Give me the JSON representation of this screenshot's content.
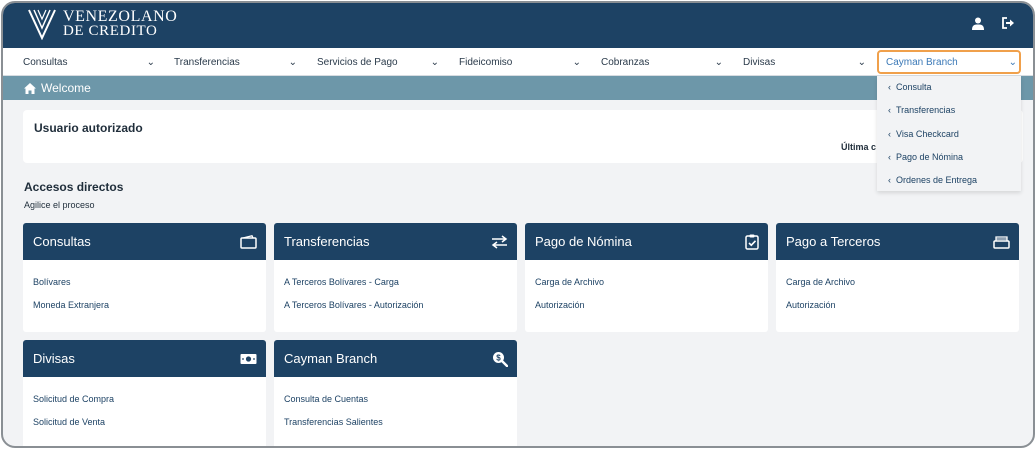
{
  "header": {
    "logo_line1": "VENEZOLANO",
    "logo_line2": "DE CREDITO",
    "icons": [
      "user-icon",
      "logout-icon"
    ]
  },
  "nav": {
    "items": [
      {
        "label": "Consultas"
      },
      {
        "label": "Transferencias"
      },
      {
        "label": "Servicios de Pago"
      },
      {
        "label": "Fideicomiso"
      },
      {
        "label": "Cobranzas"
      },
      {
        "label": "Divisas"
      },
      {
        "label": "Cayman Branch"
      }
    ],
    "active": "Cayman Branch"
  },
  "breadcrumb": {
    "label": "Welcome"
  },
  "user_panel": {
    "title": "Usuario autorizado",
    "last_access": "Última c"
  },
  "shortcuts": {
    "title": "Accesos directos",
    "subtitle": "Agilice el proceso"
  },
  "cards": [
    {
      "title": "Consultas",
      "icon": "wallet-icon",
      "links": [
        "Bolívares",
        "Moneda Extranjera"
      ]
    },
    {
      "title": "Transferencias",
      "icon": "transfer-arrows-icon",
      "links": [
        "A Terceros Bolívares - Carga",
        "A Terceros Bolívares - Autorización"
      ]
    },
    {
      "title": "Pago de Nómina",
      "icon": "clipboard-check-icon",
      "links": [
        "Carga de Archivo",
        "Autorización"
      ]
    },
    {
      "title": "Pago a Terceros",
      "icon": "cash-register-icon",
      "links": [
        "Carga de Archivo",
        "Autorización"
      ]
    },
    {
      "title": "Divisas",
      "icon": "banknote-icon",
      "links": [
        "Solicitud de Compra",
        "Solicitud de Venta"
      ]
    },
    {
      "title": "Cayman Branch",
      "icon": "search-dollar-icon",
      "links": [
        "Consulta de Cuentas",
        "Transferencias Salientes"
      ]
    }
  ],
  "dropdown": {
    "items": [
      "Consulta",
      "Transferencias",
      "Visa Checkcard",
      "Pago de Nómina",
      "Ordenes de Entrega"
    ]
  },
  "colors": {
    "primary": "#1d4264",
    "breadcrumb": "#6d97a9",
    "highlight": "#f0a04b",
    "link": "#3b79b7"
  }
}
